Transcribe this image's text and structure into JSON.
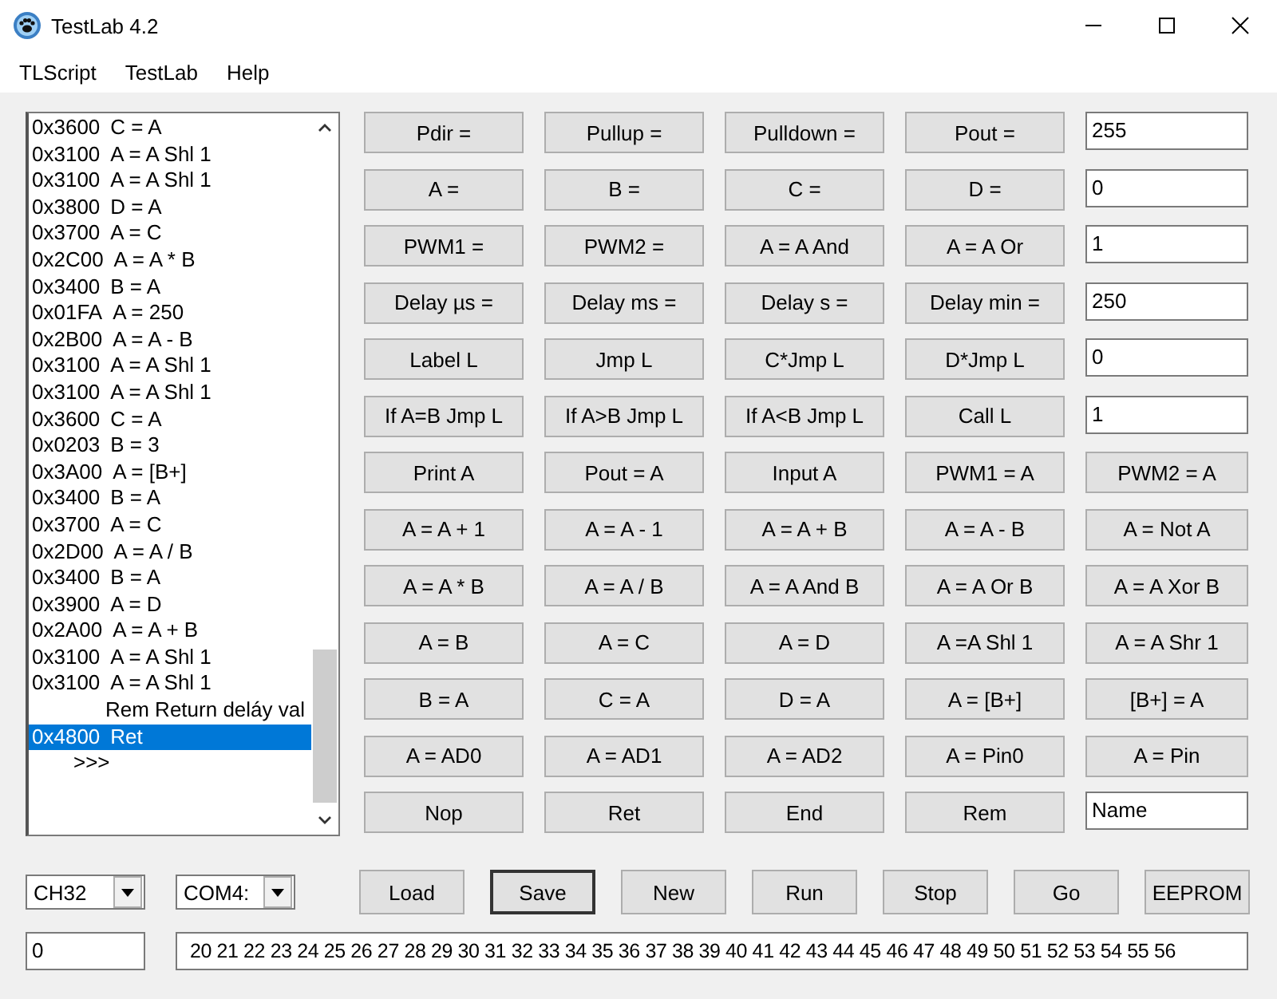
{
  "window": {
    "title": "TestLab 4.2"
  },
  "menu": [
    "TLScript",
    "TestLab",
    "Help"
  ],
  "program_list": {
    "items": [
      {
        "kind": "line",
        "address": "0x3600",
        "text": "C = A",
        "selected": false
      },
      {
        "kind": "line",
        "address": "0x3100",
        "text": "A = A Shl 1",
        "selected": false
      },
      {
        "kind": "line",
        "address": "0x3100",
        "text": "A = A Shl 1",
        "selected": false
      },
      {
        "kind": "line",
        "address": "0x3800",
        "text": "D = A",
        "selected": false
      },
      {
        "kind": "line",
        "address": "0x3700",
        "text": "A = C",
        "selected": false
      },
      {
        "kind": "line",
        "address": "0x2C00",
        "text": "A = A * B",
        "selected": false
      },
      {
        "kind": "line",
        "address": "0x3400",
        "text": "B = A",
        "selected": false
      },
      {
        "kind": "line",
        "address": "0x01FA",
        "text": "A = 250",
        "selected": false
      },
      {
        "kind": "line",
        "address": "0x2B00",
        "text": "A = A - B",
        "selected": false
      },
      {
        "kind": "line",
        "address": "0x3100",
        "text": "A = A Shl 1",
        "selected": false
      },
      {
        "kind": "line",
        "address": "0x3100",
        "text": "A = A Shl 1",
        "selected": false
      },
      {
        "kind": "line",
        "address": "0x3600",
        "text": "C = A",
        "selected": false
      },
      {
        "kind": "line",
        "address": "0x0203",
        "text": "B = 3",
        "selected": false
      },
      {
        "kind": "line",
        "address": "0x3A00",
        "text": "A = [B+]",
        "selected": false
      },
      {
        "kind": "line",
        "address": "0x3400",
        "text": "B = A",
        "selected": false
      },
      {
        "kind": "line",
        "address": "0x3700",
        "text": "A = C",
        "selected": false
      },
      {
        "kind": "line",
        "address": "0x2D00",
        "text": "A = A / B",
        "selected": false
      },
      {
        "kind": "line",
        "address": "0x3400",
        "text": "B = A",
        "selected": false
      },
      {
        "kind": "line",
        "address": "0x3900",
        "text": "A = D",
        "selected": false
      },
      {
        "kind": "line",
        "address": "0x2A00",
        "text": "A = A + B",
        "selected": false
      },
      {
        "kind": "line",
        "address": "0x3100",
        "text": "A = A Shl 1",
        "selected": false
      },
      {
        "kind": "line",
        "address": "0x3100",
        "text": "A = A Shl 1",
        "selected": false
      },
      {
        "kind": "comment",
        "text": "Rem Return deláy val",
        "selected": false
      },
      {
        "kind": "line",
        "address": "0x4800",
        "text": "Ret",
        "selected": true
      },
      {
        "kind": "end",
        "text": ">>>",
        "selected": false
      }
    ]
  },
  "command_grid": [
    [
      {
        "kind": "button",
        "label": "Pdir ="
      },
      {
        "kind": "button",
        "label": "Pullup ="
      },
      {
        "kind": "button",
        "label": "Pulldown ="
      },
      {
        "kind": "button",
        "label": "Pout ="
      },
      {
        "kind": "field",
        "value": "255"
      }
    ],
    [
      {
        "kind": "button",
        "label": "A ="
      },
      {
        "kind": "button",
        "label": "B ="
      },
      {
        "kind": "button",
        "label": "C ="
      },
      {
        "kind": "button",
        "label": "D ="
      },
      {
        "kind": "field",
        "value": "0"
      }
    ],
    [
      {
        "kind": "button",
        "label": "PWM1 ="
      },
      {
        "kind": "button",
        "label": "PWM2 ="
      },
      {
        "kind": "button",
        "label": "A = A And"
      },
      {
        "kind": "button",
        "label": "A = A Or"
      },
      {
        "kind": "field",
        "value": "1"
      }
    ],
    [
      {
        "kind": "button",
        "label": "Delay µs ="
      },
      {
        "kind": "button",
        "label": "Delay ms ="
      },
      {
        "kind": "button",
        "label": "Delay s ="
      },
      {
        "kind": "button",
        "label": "Delay min ="
      },
      {
        "kind": "field",
        "value": "250"
      }
    ],
    [
      {
        "kind": "button",
        "label": "Label L"
      },
      {
        "kind": "button",
        "label": "Jmp L"
      },
      {
        "kind": "button",
        "label": "C*Jmp L"
      },
      {
        "kind": "button",
        "label": "D*Jmp L"
      },
      {
        "kind": "field",
        "value": "0"
      }
    ],
    [
      {
        "kind": "button",
        "label": "If A=B Jmp L"
      },
      {
        "kind": "button",
        "label": "If A>B Jmp L"
      },
      {
        "kind": "button",
        "label": "If A<B Jmp L"
      },
      {
        "kind": "button",
        "label": "Call L"
      },
      {
        "kind": "field",
        "value": "1"
      }
    ],
    [
      {
        "kind": "button",
        "label": "Print A"
      },
      {
        "kind": "button",
        "label": "Pout = A"
      },
      {
        "kind": "button",
        "label": "Input A"
      },
      {
        "kind": "button",
        "label": "PWM1 = A"
      },
      {
        "kind": "button",
        "label": "PWM2 = A"
      }
    ],
    [
      {
        "kind": "button",
        "label": "A = A + 1"
      },
      {
        "kind": "button",
        "label": "A = A - 1"
      },
      {
        "kind": "button",
        "label": "A = A + B"
      },
      {
        "kind": "button",
        "label": "A = A - B"
      },
      {
        "kind": "button",
        "label": "A = Not A"
      }
    ],
    [
      {
        "kind": "button",
        "label": "A = A * B"
      },
      {
        "kind": "button",
        "label": "A = A / B"
      },
      {
        "kind": "button",
        "label": "A = A And B"
      },
      {
        "kind": "button",
        "label": "A = A Or B"
      },
      {
        "kind": "button",
        "label": "A = A Xor B"
      }
    ],
    [
      {
        "kind": "button",
        "label": "A = B"
      },
      {
        "kind": "button",
        "label": "A = C"
      },
      {
        "kind": "button",
        "label": "A = D"
      },
      {
        "kind": "button",
        "label": "A =A Shl 1"
      },
      {
        "kind": "button",
        "label": "A = A Shr 1"
      }
    ],
    [
      {
        "kind": "button",
        "label": "B = A"
      },
      {
        "kind": "button",
        "label": "C = A"
      },
      {
        "kind": "button",
        "label": "D = A"
      },
      {
        "kind": "button",
        "label": "A = [B+]"
      },
      {
        "kind": "button",
        "label": "[B+] = A"
      }
    ],
    [
      {
        "kind": "button",
        "label": "A = AD0"
      },
      {
        "kind": "button",
        "label": "A = AD1"
      },
      {
        "kind": "button",
        "label": "A = AD2"
      },
      {
        "kind": "button",
        "label": "A = Pin0"
      },
      {
        "kind": "button",
        "label": "A = Pin"
      }
    ],
    [
      {
        "kind": "button",
        "label": "Nop"
      },
      {
        "kind": "button",
        "label": "Ret"
      },
      {
        "kind": "button",
        "label": "End"
      },
      {
        "kind": "button",
        "label": "Rem"
      },
      {
        "kind": "field",
        "value": "Name"
      }
    ]
  ],
  "device_select": {
    "value": "CH32"
  },
  "port_select": {
    "value": "COM4:"
  },
  "actions": [
    {
      "label": "Load",
      "default": false
    },
    {
      "label": "Save",
      "default": true
    },
    {
      "label": "New",
      "default": false
    },
    {
      "label": "Run",
      "default": false
    },
    {
      "label": "Stop",
      "default": false
    },
    {
      "label": "Go",
      "default": false
    },
    {
      "label": "EEPROM",
      "default": false
    }
  ],
  "value_field": {
    "value": "0"
  },
  "output_field": {
    "value": "20 21 22 23 24 25 26 27 28 29 30 31 32 33 34 35 36 37 38 39 40 41 42 43 44 45 46 47 48 49 50 51 52 53 54 55 56"
  }
}
